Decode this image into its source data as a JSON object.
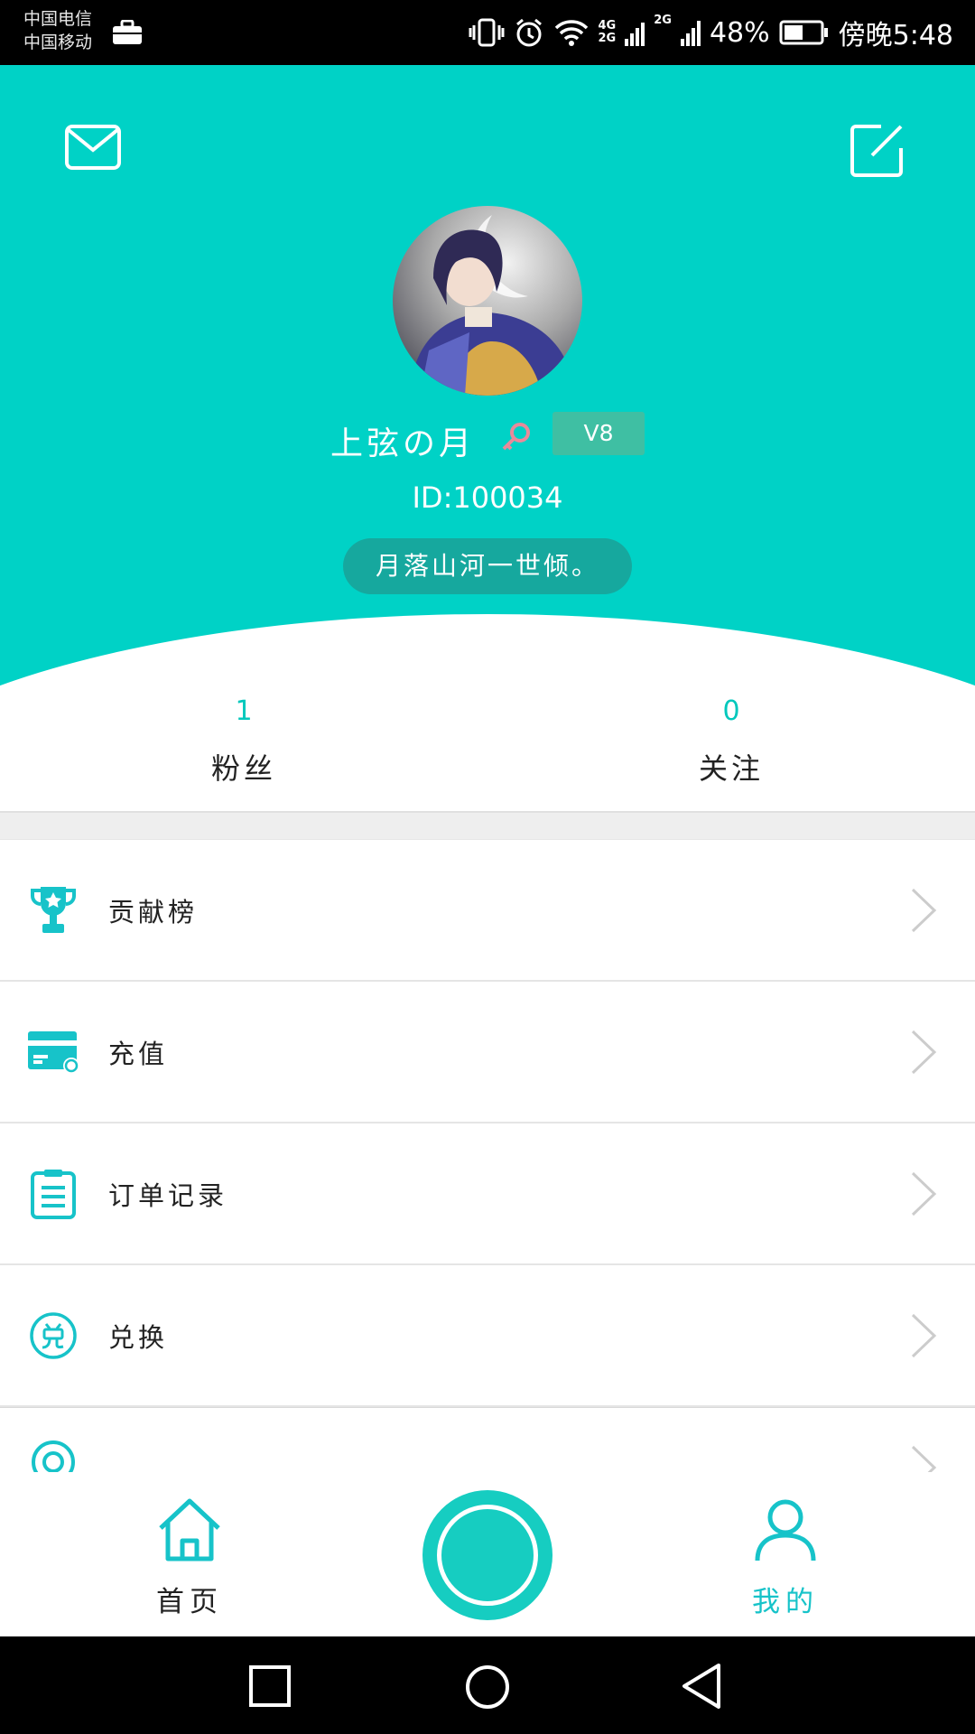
{
  "status_bar": {
    "carrier_1": "中国电信",
    "carrier_2": "中国移动",
    "net_1_top": "4G",
    "net_1_bottom": "2G",
    "net_2": "2G",
    "battery": "48%",
    "time": "傍晚5:48"
  },
  "header": {
    "username": "上弦の月",
    "level": "V8",
    "user_id": "ID:100034",
    "signature": "月落山河一世倾。",
    "bg_color": "#00d2c6"
  },
  "stats": {
    "fans_count": "1",
    "fans_label": "粉丝",
    "following_count": "0",
    "following_label": "关注"
  },
  "menu": {
    "items": [
      {
        "label": "贡献榜",
        "icon": "trophy-icon"
      },
      {
        "label": "充值",
        "icon": "card-icon"
      },
      {
        "label": "订单记录",
        "icon": "clipboard-icon"
      },
      {
        "label": "兑换",
        "icon": "exchange-icon"
      },
      {
        "label": "",
        "icon": "partial-icon"
      }
    ]
  },
  "bottom_nav": {
    "home_label": "首页",
    "mine_label": "我的",
    "accent_color": "#17c3c9"
  }
}
